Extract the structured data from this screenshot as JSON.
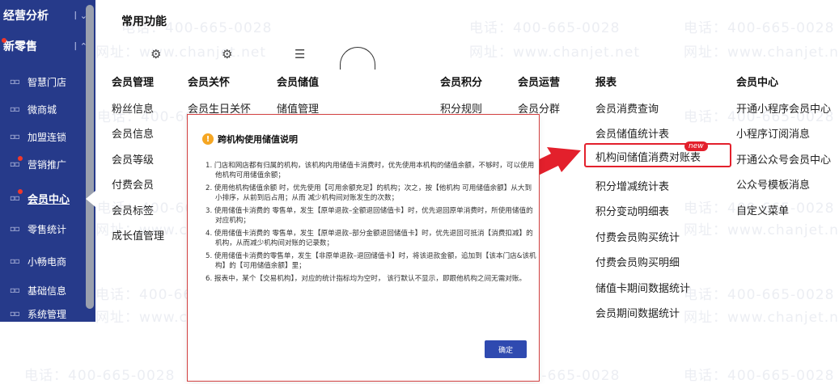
{
  "sidebar": {
    "top_items": [
      {
        "label": "经营分析",
        "caret": "丨⌄"
      },
      {
        "label": "新零售",
        "caret": "丨⌃"
      }
    ],
    "items": [
      {
        "label": "智慧门店",
        "icon": "grid-icon"
      },
      {
        "label": "微商城",
        "icon": "grid-icon"
      },
      {
        "label": "加盟连锁",
        "icon": "grid-icon"
      },
      {
        "label": "营销推广",
        "icon": "grid-icon",
        "dot": true
      },
      {
        "label": "会员中心",
        "icon": "grid-icon",
        "dot": true,
        "active": true
      },
      {
        "label": "零售统计",
        "icon": "grid-icon"
      },
      {
        "label": "小畅电商",
        "icon": "grid-icon"
      },
      {
        "label": "基础信息",
        "icon": "grid-icon"
      },
      {
        "label": "系统管理",
        "icon": "grid-icon"
      }
    ]
  },
  "main": {
    "section_title": "常用功能",
    "columns": [
      {
        "header": "会员管理",
        "items": [
          "粉丝信息",
          "会员信息",
          "会员等级",
          "付费会员",
          "会员标签",
          "成长值管理"
        ]
      },
      {
        "header": "会员关怀",
        "items": [
          "会员生日关怀"
        ]
      },
      {
        "header": "会员储值",
        "items": [
          "储值管理"
        ]
      },
      {
        "header": "会员积分",
        "items": [
          "积分规则"
        ]
      },
      {
        "header": "会员运营",
        "items": [
          "会员分群"
        ]
      },
      {
        "header": "报表",
        "items": [
          "会员消费查询",
          "会员储值统计表",
          "机构间储值消费对账表",
          "积分增减统计表",
          "积分变动明细表",
          "付费会员购买统计",
          "付费会员购买明细",
          "储值卡期间数据统计",
          "会员期间数据统计"
        ]
      },
      {
        "header": "会员中心",
        "items": [
          "开通小程序会员中心",
          "小程序订阅消息",
          "开通公众号会员中心",
          "公众号模板消息",
          "自定义菜单"
        ]
      }
    ],
    "new_badge": "new"
  },
  "modal": {
    "title": "跨机构使用储值说明",
    "lines": [
      "1. 门店和网店都有归属的机构，该机构内用储值卡消费时，优先使用本机构的储值余额，不够时，可以使用他机构可用储值余额；",
      "2. 使用他机构储值余额 时，优先使用【可用余额充足】的机构；次之，按【他机构 可用储值余额】从大到小排序，从前到后占用；从而 减少机构间对账发生的次数；",
      "3. 使用储值卡消费的 零售单，发生【原单退款–全额退回储值卡】时，优先退回原单消费时，所使用储值的对应机构；",
      "4. 使用储值卡消费的 零售单，发生【原单退款–部分金额退回储值卡】时，优先退回可抵消【消费扣减】的机构，从而减少机构间对账的记录数；",
      "5. 使用储值卡消费的零售单，发生【非原单退款–退回储值卡】时，将该退款金额，追加到【该本门店&该机构】的【可用储值余额】里；",
      "6. 报表中，某个【交易机构】，对应的统计指标均为空时， 该行默认不显示，即跟他机构之间无需对账。"
    ],
    "ok_label": "确定"
  },
  "watermark": {
    "phone": "电话：400-665-0028",
    "site": "网址：www.chanjet.net"
  },
  "colors": {
    "sidebar_bg": "#263a8a",
    "accent_red": "#e3202c",
    "button_blue": "#2f4ab0",
    "warning": "#f5a623"
  }
}
